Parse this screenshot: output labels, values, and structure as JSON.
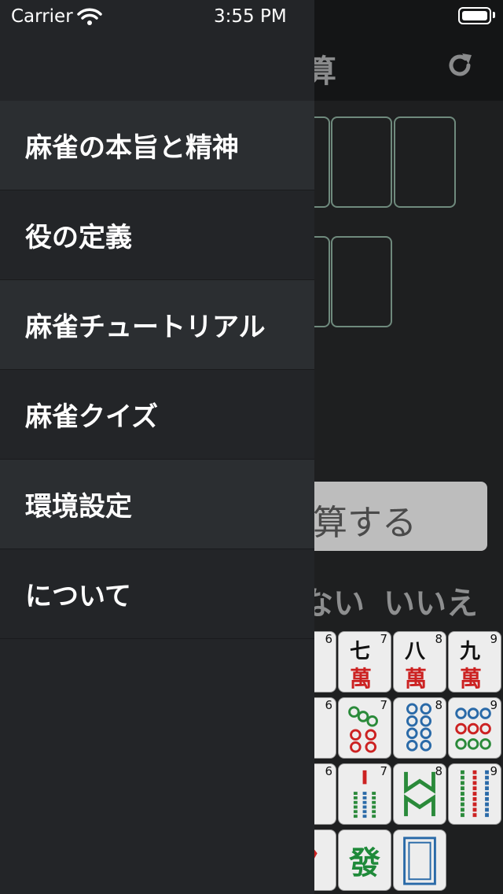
{
  "status_bar": {
    "carrier": "Carrier",
    "time": "3:55 PM"
  },
  "background": {
    "title_partial": "算",
    "calc_button_partial": "算する",
    "no_partial": "ない",
    "yes_label": "いいえ",
    "tiles": {
      "man": [
        {
          "top": "七",
          "bottom": "萬",
          "num": "7"
        },
        {
          "top": "八",
          "bottom": "萬",
          "num": "8"
        },
        {
          "top": "九",
          "bottom": "萬",
          "num": "9"
        }
      ],
      "partial_nums": [
        "6",
        "6",
        "6"
      ],
      "row2_nums": [
        "7",
        "8",
        "9"
      ],
      "row3_nums": [
        "7",
        "8",
        "9"
      ],
      "hatsu": "發"
    }
  },
  "drawer": {
    "items": [
      {
        "label": "麻雀の本旨と精神"
      },
      {
        "label": "役の定義"
      },
      {
        "label": "麻雀チュートリアル"
      },
      {
        "label": "麻雀クイズ"
      },
      {
        "label": "環境設定"
      },
      {
        "label": "について"
      }
    ]
  }
}
